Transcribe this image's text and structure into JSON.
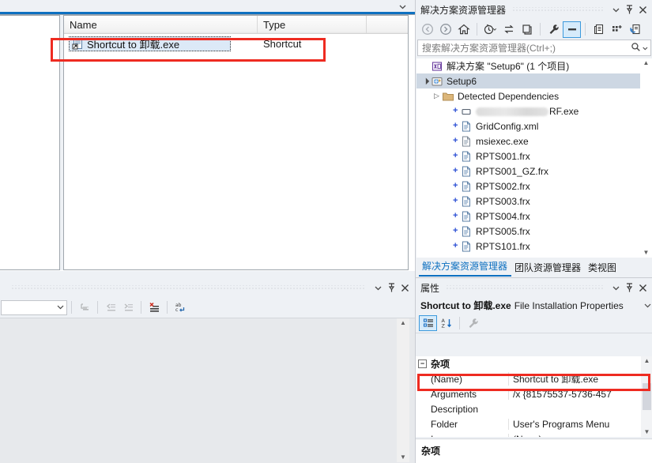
{
  "editor": {
    "tab_chevron_icon": "chevron-down-icon",
    "columns": [
      "Name",
      "Type",
      ""
    ],
    "rows": [
      {
        "icon": "shortcut-file-icon",
        "name": "Shortcut to 卸载.exe",
        "type": "Shortcut",
        "editing": true
      }
    ]
  },
  "bottom_left_panel": {
    "title": "",
    "chevron_icon": "chevron-down-icon",
    "pin_icon": "pin-icon",
    "close_icon": "close-icon",
    "combo_value": "",
    "combo_icon": "chevron-down-icon",
    "toolbar_icons": [
      "undo-indent-icon",
      "outdent-icon",
      "indent-icon",
      "clear-all-icon",
      "word-wrap-icon"
    ],
    "scroll_up_icon": "scroll-up-arrow",
    "scroll_down_icon": "scroll-down-arrow"
  },
  "solution_explorer": {
    "title": "解决方案资源管理器",
    "chevron_icon": "chevron-down-icon",
    "pin_icon": "pin-icon",
    "close_icon": "close-icon",
    "toolbar": [
      {
        "name": "back-icon",
        "label": "",
        "selected": false
      },
      {
        "name": "forward-icon",
        "label": "",
        "selected": false
      },
      {
        "name": "home-icon",
        "label": "",
        "selected": false
      },
      {
        "name": "pending-changes-icon",
        "label": "",
        "selected": false
      },
      {
        "name": "sync-with-active-document-icon",
        "label": "",
        "selected": false
      },
      {
        "name": "collapse-all-icon",
        "label": "",
        "selected": false
      },
      {
        "name": "properties-wrench-icon",
        "label": "",
        "selected": false
      },
      {
        "name": "preview-selected-items-icon",
        "label": "",
        "selected": true
      },
      {
        "name": "show-all-files-icon",
        "label": "",
        "selected": false
      },
      {
        "name": "add-new-item-icon",
        "label": "",
        "selected": false
      },
      {
        "name": "refresh-icon",
        "label": "",
        "selected": false
      }
    ],
    "search_placeholder": "搜索解决方案资源管理器(Ctrl+;)",
    "search_value": "",
    "search_icon": "magnifier-icon",
    "search_dropdown_icon": "chevron-down-icon",
    "tree": [
      {
        "indent": 0,
        "twisty": "",
        "icon": "solution-icon",
        "label": "解决方案 \"Setup6\" (1 个项目)",
        "selected": false,
        "redacted": false
      },
      {
        "indent": 0,
        "twisty": "▲",
        "icon": "setup-project-icon",
        "label": "Setup6",
        "selected": true,
        "redacted": false
      },
      {
        "indent": 1,
        "twisty": "▶",
        "icon": "folder-icon",
        "label": "Detected Dependencies",
        "selected": false,
        "redacted": false
      },
      {
        "indent": 2,
        "twisty": "",
        "icon": "exe-output-icon",
        "label": "RF.exe",
        "selected": false,
        "redacted": true
      },
      {
        "indent": 2,
        "twisty": "",
        "icon": "file-icon",
        "label": "GridConfig.xml",
        "selected": false,
        "redacted": false
      },
      {
        "indent": 2,
        "twisty": "",
        "icon": "file-plain-icon",
        "label": "msiexec.exe",
        "selected": false,
        "redacted": false
      },
      {
        "indent": 2,
        "twisty": "",
        "icon": "file-icon",
        "label": "RPTS001.frx",
        "selected": false,
        "redacted": false
      },
      {
        "indent": 2,
        "twisty": "",
        "icon": "file-icon",
        "label": "RPTS001_GZ.frx",
        "selected": false,
        "redacted": false
      },
      {
        "indent": 2,
        "twisty": "",
        "icon": "file-icon",
        "label": "RPTS002.frx",
        "selected": false,
        "redacted": false
      },
      {
        "indent": 2,
        "twisty": "",
        "icon": "file-icon",
        "label": "RPTS003.frx",
        "selected": false,
        "redacted": false
      },
      {
        "indent": 2,
        "twisty": "",
        "icon": "file-icon",
        "label": "RPTS004.frx",
        "selected": false,
        "redacted": false
      },
      {
        "indent": 2,
        "twisty": "",
        "icon": "file-icon",
        "label": "RPTS005.frx",
        "selected": false,
        "redacted": false
      },
      {
        "indent": 2,
        "twisty": "",
        "icon": "file-icon",
        "label": "RPTS101.frx",
        "selected": false,
        "redacted": false
      }
    ],
    "scroll_up_icon": "scroll-up-arrow",
    "scroll_down_icon": "scroll-down-arrow",
    "tabs": [
      {
        "label": "解决方案资源管理器",
        "active": true
      },
      {
        "label": "团队资源管理器",
        "active": false
      },
      {
        "label": "类视图",
        "active": false
      }
    ]
  },
  "properties": {
    "title": "属性",
    "chevron_icon": "chevron-down-icon",
    "pin_icon": "pin-icon",
    "close_icon": "close-icon",
    "object_name": "Shortcut to 卸载.exe",
    "object_type": "File Installation Properties",
    "object_dropdown_icon": "chevron-down-icon",
    "toolbar": [
      {
        "name": "categorized-view-icon",
        "selected": true
      },
      {
        "name": "alphabetical-sort-icon",
        "selected": false
      },
      {
        "name": "property-pages-wrench-icon",
        "selected": false
      }
    ],
    "category": "杂项",
    "category_expander": "−",
    "rows": [
      {
        "name": "(Name)",
        "value": "Shortcut to 卸载.exe",
        "highlighted": false
      },
      {
        "name": "Arguments",
        "value": "/x {81575537-5736-457",
        "highlighted": true
      },
      {
        "name": "Description",
        "value": "",
        "highlighted": false
      },
      {
        "name": "Folder",
        "value": "User's Programs Menu",
        "highlighted": false
      },
      {
        "name": "Icon",
        "value": "(None)",
        "highlighted": false
      }
    ],
    "scroll_up_icon": "scroll-up-arrow",
    "scroll_down_icon": "scroll-down-arrow",
    "description_title": "杂项",
    "description_text": ""
  },
  "annotations": {
    "accent_color": "#ee2b21",
    "highlight_boxes": [
      "editor-row-highlight",
      "arguments-row-highlight"
    ]
  }
}
